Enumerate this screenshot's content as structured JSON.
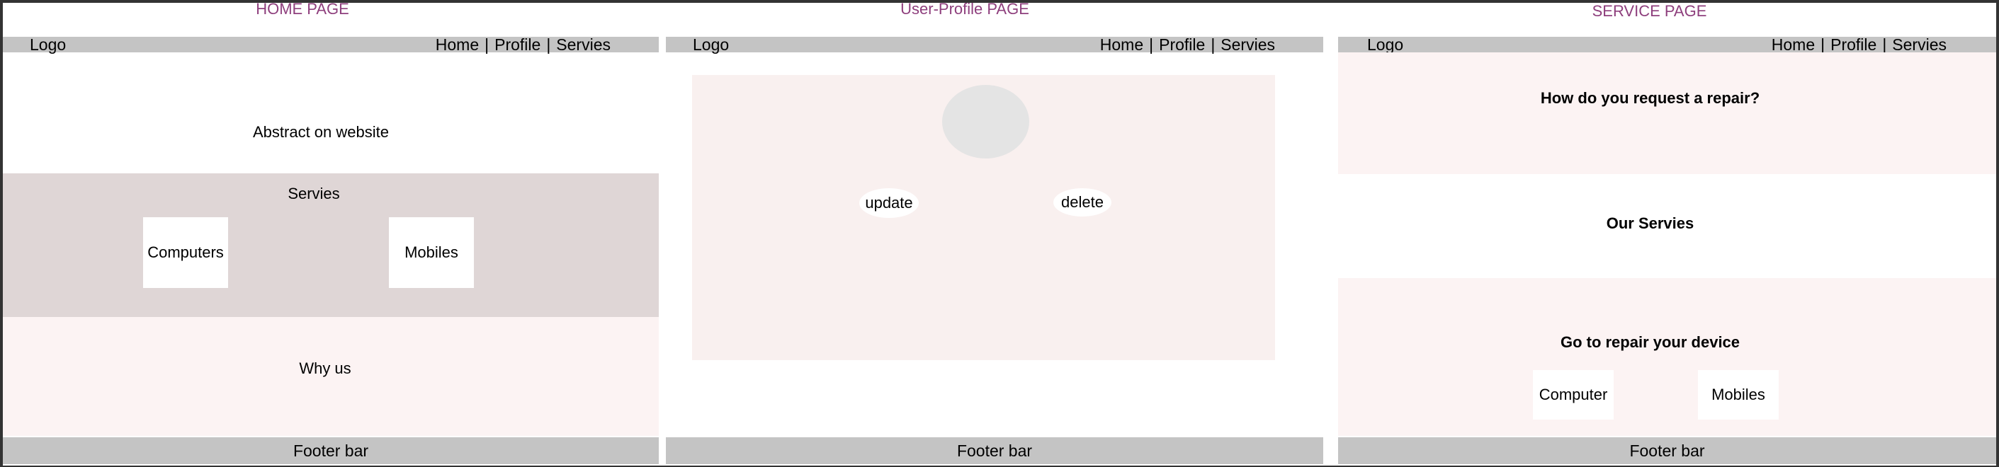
{
  "colors": {
    "title": "#8e3f7d",
    "nav_bar": "#c4c4c4",
    "services_bg": "#dfd6d6",
    "pink_bg": "#fcf3f3",
    "profile_card_bg": "#f9f0ef",
    "avatar": "#e4e4e4",
    "frame": "#333333"
  },
  "home": {
    "title": "HOME PAGE",
    "nav": {
      "logo": "Logo",
      "links": [
        "Home",
        "Profile",
        "Servies"
      ],
      "separator": "|"
    },
    "abstract": "Abstract on website",
    "services": {
      "heading": "Servies",
      "cards": [
        "Computers",
        "Mobiles"
      ]
    },
    "why_us": "Why us",
    "footer": "Footer bar"
  },
  "profile": {
    "title": "User-Profile PAGE",
    "nav": {
      "logo": "Logo",
      "links": [
        "Home",
        "Profile",
        "Servies"
      ],
      "separator": "|"
    },
    "update": "update",
    "delete": "delete",
    "footer": "Footer bar"
  },
  "service": {
    "title": "SERVICE PAGE",
    "nav": {
      "logo": "Logo",
      "links": [
        "Home",
        "Profile",
        "Servies"
      ],
      "separator": "|"
    },
    "request_heading": "How do you request a repair?",
    "our_services": "Our Servies",
    "repair_heading": "Go to repair your device",
    "cards": [
      "Computer",
      "Mobiles"
    ],
    "footer": "Footer bar"
  }
}
